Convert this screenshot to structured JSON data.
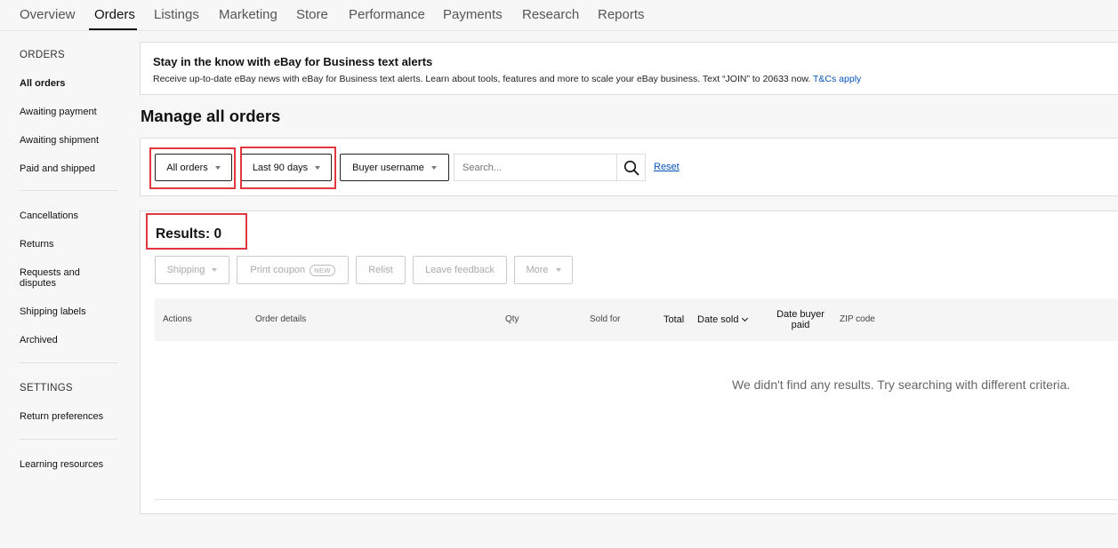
{
  "topnav": {
    "tabs": [
      {
        "label": "Overview"
      },
      {
        "label": "Orders",
        "active": true
      },
      {
        "label": "Listings"
      },
      {
        "label": "Marketing"
      },
      {
        "label": "Store"
      },
      {
        "label": "Performance"
      },
      {
        "label": "Payments"
      },
      {
        "label": "Research"
      },
      {
        "label": "Reports"
      }
    ]
  },
  "sidebar": {
    "orders_heading": "ORDERS",
    "orders_items": [
      "All orders",
      "Awaiting payment",
      "Awaiting shipment",
      "Paid and shipped"
    ],
    "other_items": [
      "Cancellations",
      "Returns",
      "Requests and disputes",
      "Shipping labels",
      "Archived"
    ],
    "settings_heading": "SETTINGS",
    "settings_items": [
      "Return preferences"
    ],
    "learning": "Learning resources",
    "active_item": "All orders"
  },
  "alert": {
    "title": "Stay in the know with eBay for Business text alerts",
    "body": "Receive up-to-date eBay news with eBay for Business text alerts. Learn about tools, features and more to scale your eBay business. Text “JOIN” to 20633 now.",
    "link": "T&Cs apply"
  },
  "page_title": "Manage all orders",
  "filters": {
    "order_status": "All orders",
    "period": "Last 90 days",
    "search_by": "Buyer username",
    "search_placeholder": "Search...",
    "reset": "Reset"
  },
  "results": {
    "label": "Results: 0",
    "count": 0
  },
  "actions": {
    "shipping": "Shipping",
    "print_coupon": "Print coupon",
    "new_badge": "NEW",
    "relist": "Relist",
    "leave_feedback": "Leave feedback",
    "more": "More"
  },
  "table": {
    "columns": {
      "actions": "Actions",
      "order_details": "Order details",
      "qty": "Qty",
      "sold_for": "Sold for",
      "total": "Total",
      "date_sold": "Date sold",
      "date_buyer_paid_1": "Date buyer",
      "date_buyer_paid_2": "paid",
      "zip_code": "ZIP code"
    },
    "empty_message": "We didn't find any results. Try searching with different criteria."
  },
  "colors": {
    "highlight": "#e0383e",
    "link": "#0654ba"
  }
}
